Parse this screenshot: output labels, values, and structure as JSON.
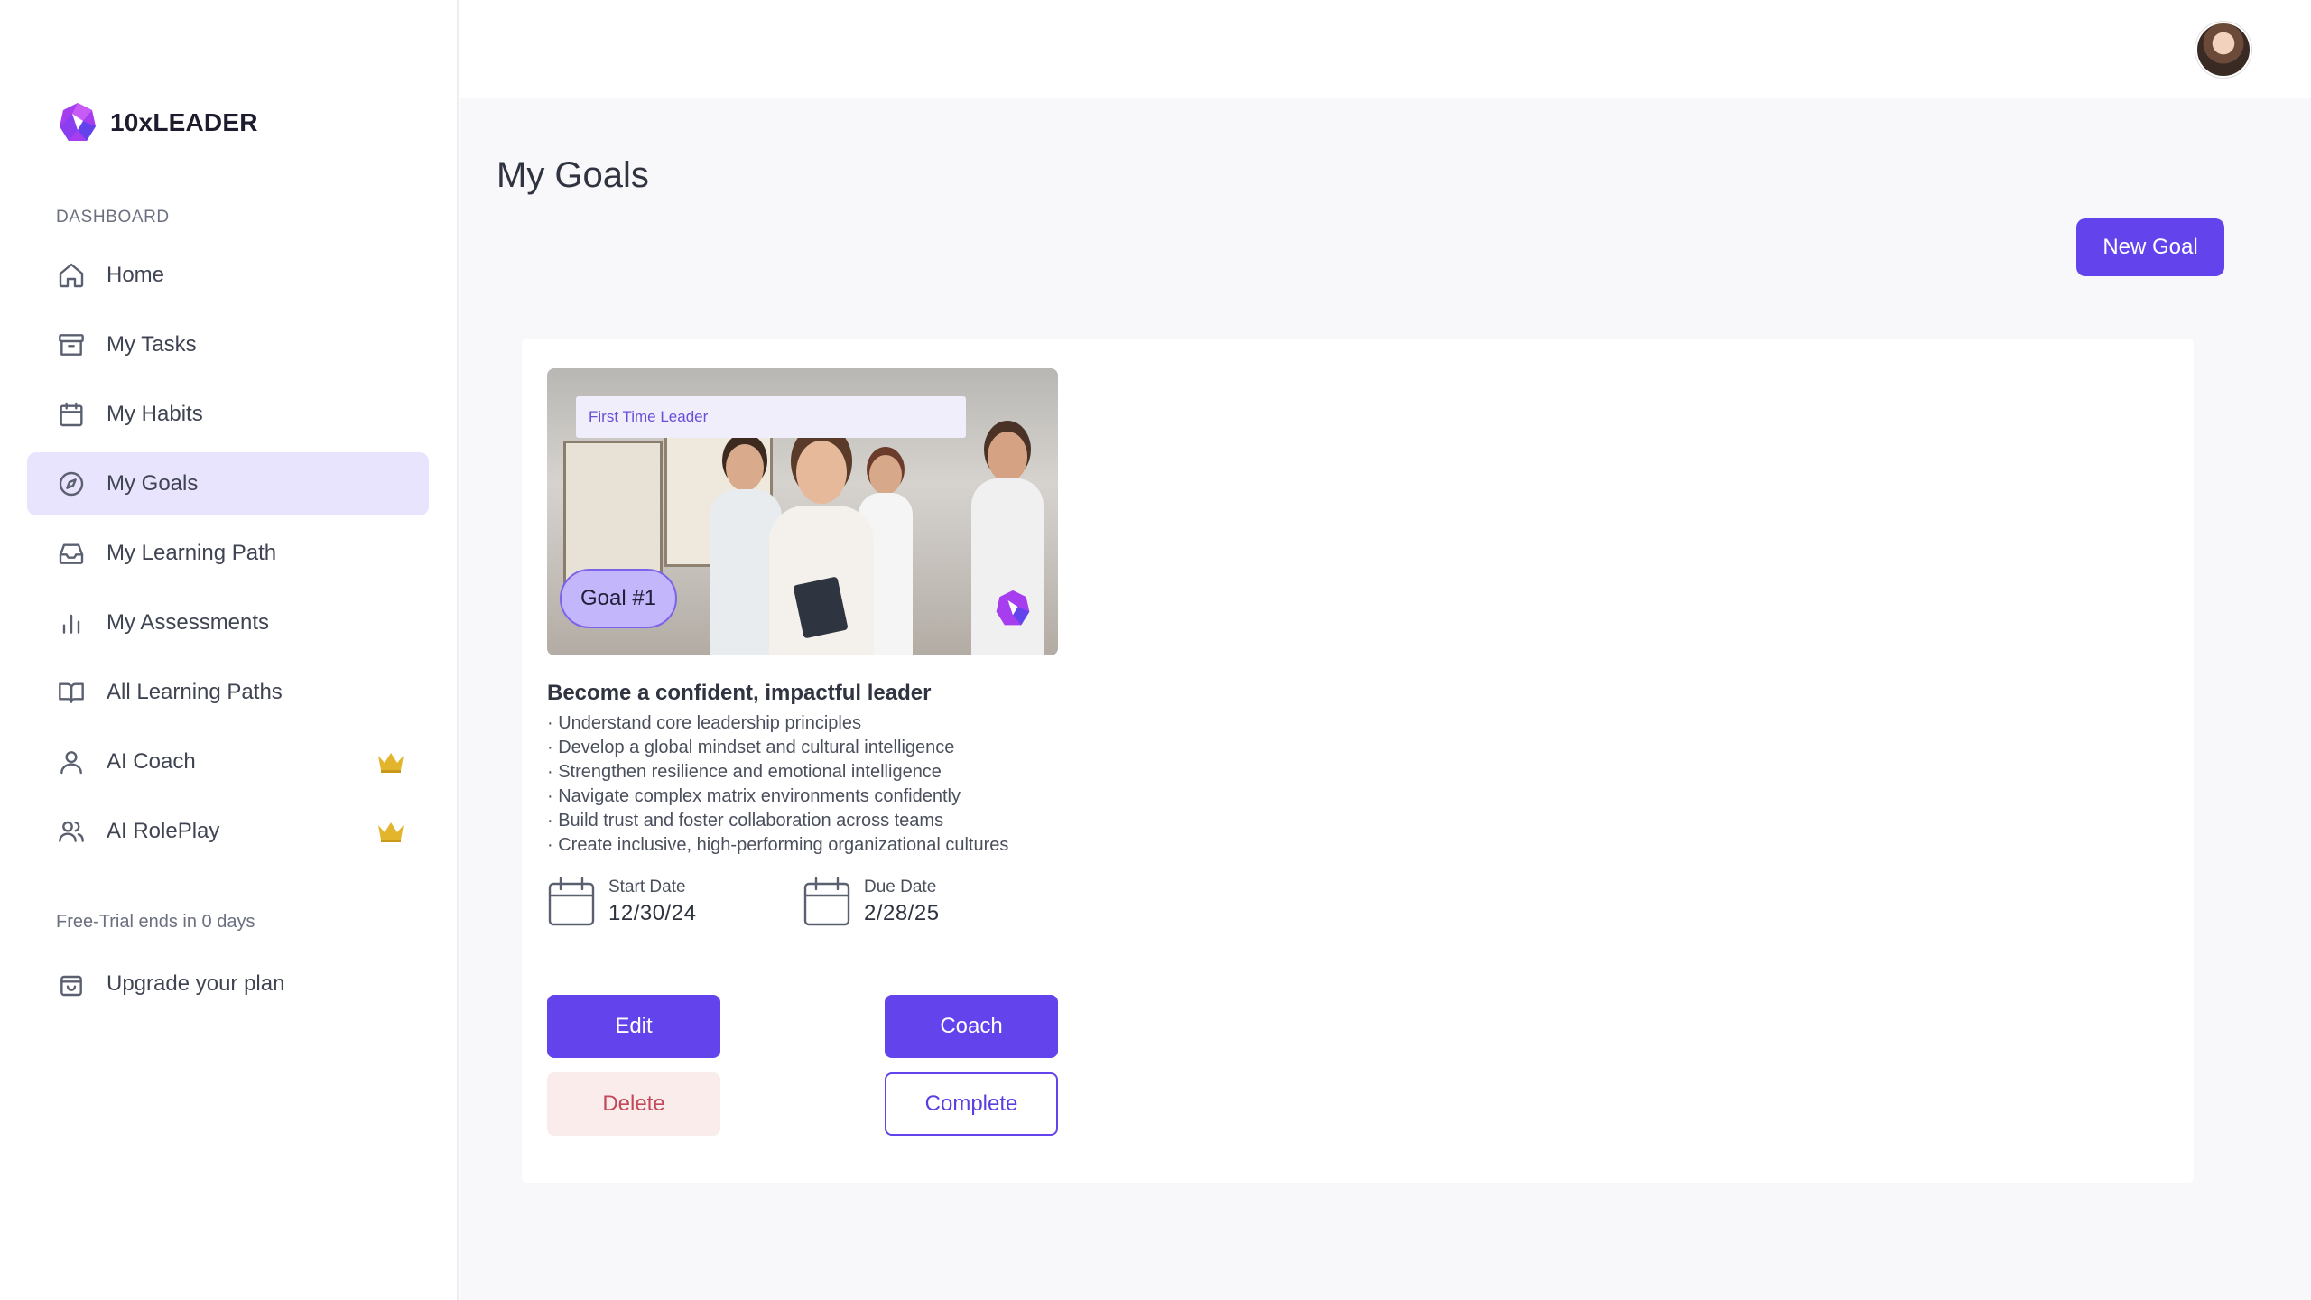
{
  "brand": {
    "name": "10xLEADER",
    "accent": "#6344ec",
    "logo_colors": [
      "#a63ef0",
      "#6344ec"
    ]
  },
  "sidebar": {
    "section_label": "DASHBOARD",
    "items": [
      {
        "label": "Home",
        "icon": "home-icon",
        "active": false
      },
      {
        "label": "My Tasks",
        "icon": "archive-icon",
        "active": false
      },
      {
        "label": "My Habits",
        "icon": "calendar-icon",
        "active": false
      },
      {
        "label": "My Goals",
        "icon": "compass-icon",
        "active": true
      },
      {
        "label": "My Learning Path",
        "icon": "inbox-icon",
        "active": false
      },
      {
        "label": "My Assessments",
        "icon": "bar-chart-icon",
        "active": false
      },
      {
        "label": "All Learning Paths",
        "icon": "book-icon",
        "active": false
      },
      {
        "label": "AI Coach",
        "icon": "user-icon",
        "active": false,
        "premium": true
      },
      {
        "label": "AI RolePlay",
        "icon": "users-icon",
        "active": false,
        "premium": true
      }
    ],
    "trial_text": "Free-Trial ends in 0 days",
    "upgrade": {
      "label": "Upgrade your plan",
      "icon": "shopping-bag-icon"
    }
  },
  "header": {
    "avatar": "user-avatar"
  },
  "main": {
    "title": "My Goals",
    "new_goal_label": "New Goal"
  },
  "goal": {
    "tag": "First Time Leader",
    "badge": "Goal #1",
    "title": "Become a confident, impactful leader",
    "bullets": [
      "· Understand core leadership principles",
      "· Develop a global mindset and cultural intelligence",
      "· Strengthen resilience and emotional intelligence",
      "· Navigate complex matrix environments confidently",
      "· Build trust and foster collaboration across teams",
      "· Create inclusive, high-performing organizational cultures"
    ],
    "start_label": "Start Date",
    "start_value": "12/30/24",
    "due_label": "Due Date",
    "due_value": "2/28/25",
    "actions": {
      "edit": "Edit",
      "coach": "Coach",
      "delete": "Delete",
      "complete": "Complete"
    }
  }
}
